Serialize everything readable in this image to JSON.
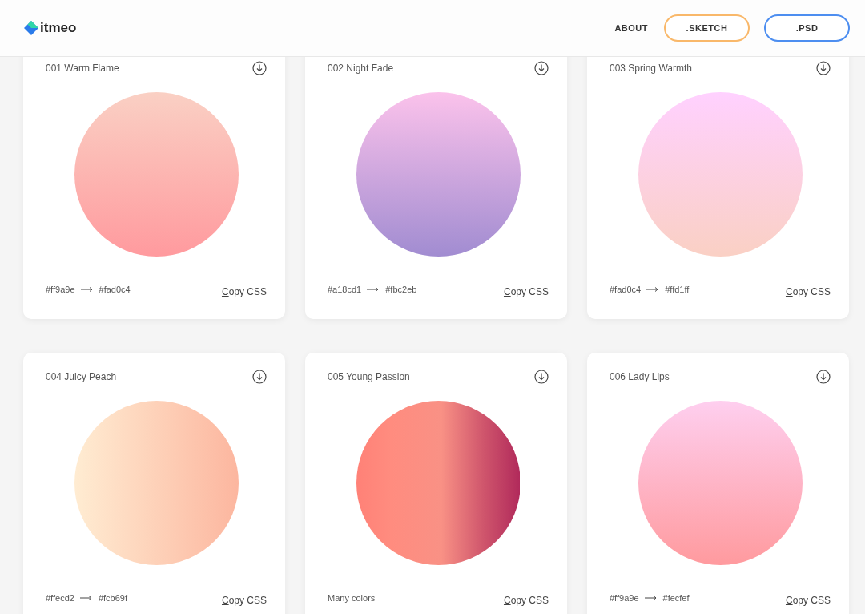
{
  "header": {
    "logo": "itmeo",
    "nav": [
      {
        "label": "ABOUT",
        "kind": "link"
      },
      {
        "label": ".SKETCH",
        "kind": "outline",
        "color": "#f9b86a"
      },
      {
        "label": ".PSD",
        "kind": "outline",
        "color": "#4d8ef0"
      }
    ]
  },
  "cards": [
    {
      "title": "001 Warm Flame",
      "kind": "pair",
      "vertical": true,
      "from": "#ff9a9e",
      "to": "#fad0c4",
      "copy": "Copy CSS"
    },
    {
      "title": "002 Night Fade",
      "kind": "pair",
      "vertical": true,
      "from": "#a18cd1",
      "to": "#fbc2eb",
      "copy": "Copy CSS"
    },
    {
      "title": "003 Spring Warmth",
      "kind": "pair",
      "vertical": true,
      "from": "#fad0c4",
      "to": "#ffd1ff",
      "copy": "Copy CSS"
    },
    {
      "title": "004 Juicy Peach",
      "kind": "pair",
      "vertical": false,
      "from": "#ffecd2",
      "to": "#fcb69f",
      "copy": "Copy CSS"
    },
    {
      "title": "005 Young Passion",
      "kind": "multi",
      "vertical": false,
      "label": "Many colors",
      "stops": [
        {
          "color": "#ff8177"
        },
        {
          "color": "#ff8c7f"
        },
        {
          "color": "#f99185"
        },
        {
          "color": "#cf556c"
        },
        {
          "color": "#b12a5b"
        }
      ],
      "copy": "Copy CSS"
    },
    {
      "title": "006 Lady Lips",
      "kind": "pair",
      "vertical": true,
      "from": "#ff9a9e",
      "to": "#fecfef",
      "copy": "Copy CSS"
    }
  ]
}
